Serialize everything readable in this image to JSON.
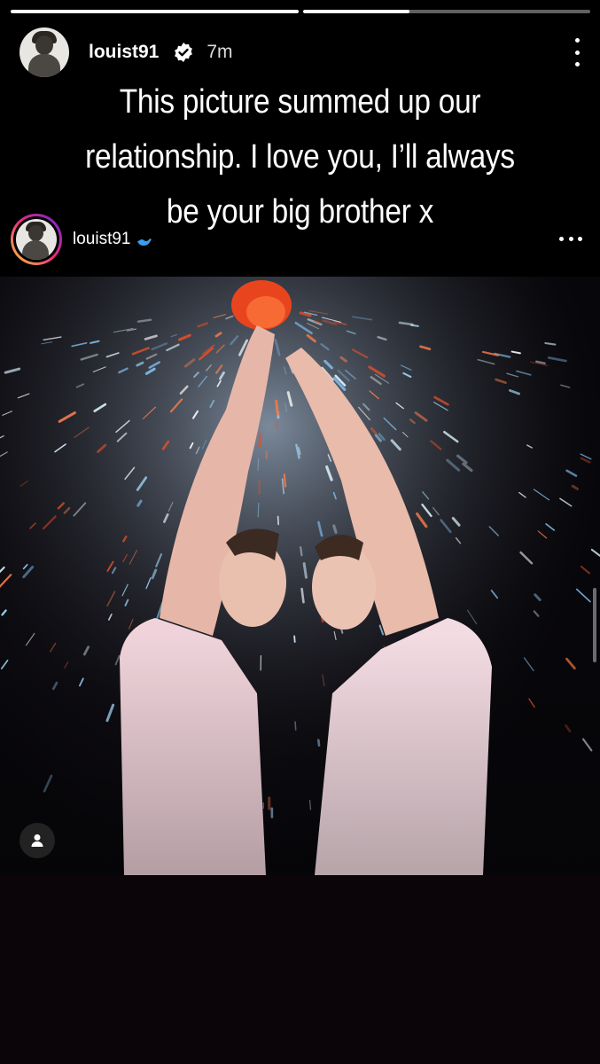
{
  "story": {
    "progress": [
      1.0,
      0.37
    ],
    "username": "louist91",
    "verified": true,
    "time_ago": "7m",
    "caption": "This picture summed up our relationship. I love you, I’ll always be your big brother x"
  },
  "post": {
    "username": "louist91",
    "badge_icon": "bird-icon",
    "tag_icon": "person-icon"
  },
  "colors": {
    "background": "#000000",
    "verified_badge": "#ffffff",
    "bird_badge": "#3b9cf0",
    "bottom_panel": "#0b0409"
  }
}
